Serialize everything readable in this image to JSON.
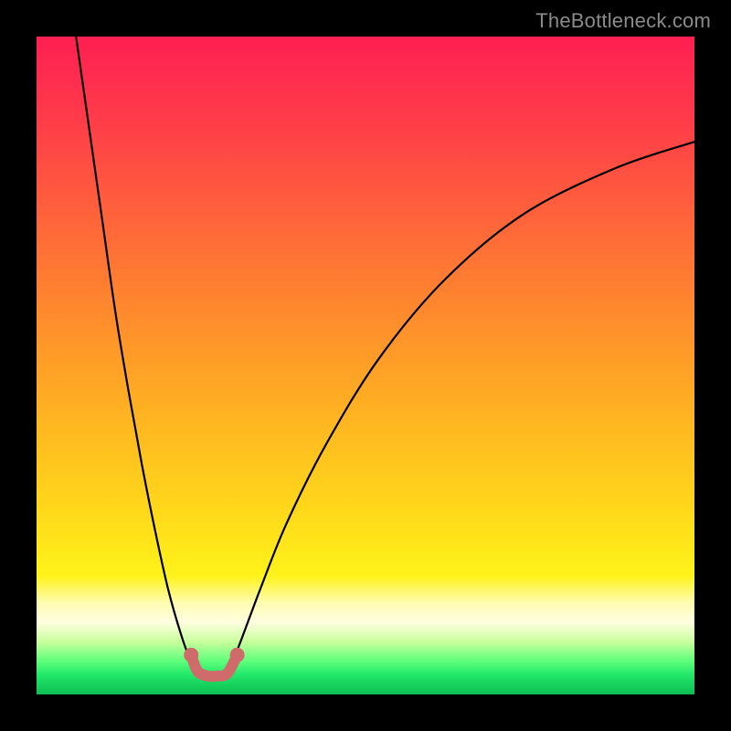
{
  "watermark": "TheBottleneck.com",
  "chart_data": {
    "type": "line",
    "title": "",
    "xlabel": "",
    "ylabel": "",
    "xlim": [
      0,
      100
    ],
    "ylim": [
      0,
      100
    ],
    "grid": false,
    "legend": false,
    "series": [
      {
        "name": "left-branch",
        "x": [
          6,
          8,
          10,
          12,
          14,
          16,
          18,
          20,
          22,
          23.5,
          25
        ],
        "y": [
          100,
          86,
          72,
          58,
          46,
          35,
          25,
          16,
          9,
          5,
          3
        ]
      },
      {
        "name": "right-branch",
        "x": [
          29,
          31,
          34,
          38,
          44,
          52,
          62,
          74,
          88,
          100
        ],
        "y": [
          3,
          8,
          16,
          26,
          38,
          51,
          63,
          73,
          80,
          84
        ]
      },
      {
        "name": "valley-highlight",
        "x": [
          23.5,
          24.5,
          26,
          27.5,
          29,
          30.5
        ],
        "y": [
          6,
          3.5,
          2.8,
          2.8,
          3.2,
          6
        ]
      }
    ],
    "background_gradient": {
      "stops": [
        {
          "pos": 0.0,
          "color": "#ff1f52"
        },
        {
          "pos": 0.36,
          "color": "#ff7a32"
        },
        {
          "pos": 0.72,
          "color": "#ffd81a"
        },
        {
          "pos": 0.86,
          "color": "#fffcb0"
        },
        {
          "pos": 0.95,
          "color": "#5cff7a"
        },
        {
          "pos": 1.0,
          "color": "#0dbd52"
        }
      ]
    }
  }
}
